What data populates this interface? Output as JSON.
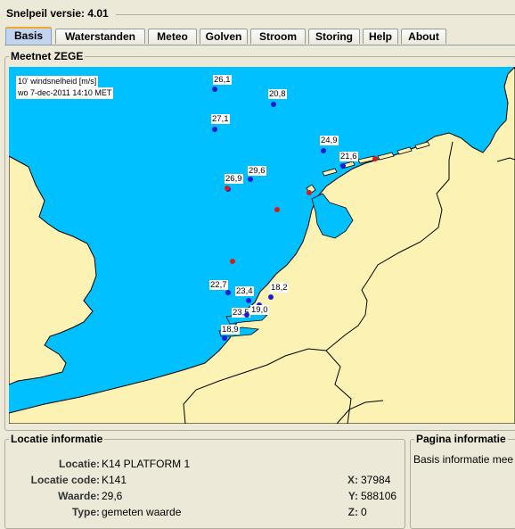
{
  "window": {
    "title": "Snelpeil versie: 4.01"
  },
  "tabs": [
    {
      "label": "Basis",
      "active": true
    },
    {
      "label": "Waterstanden"
    },
    {
      "label": "Meteo"
    },
    {
      "label": "Golven"
    },
    {
      "label": "Stroom"
    },
    {
      "label": "Storing"
    },
    {
      "label": "Help"
    },
    {
      "label": "About"
    }
  ],
  "map_panel": {
    "title": "Meetnet ZEGE",
    "legend_line1": "10' windsnelheid [m/s]",
    "legend_line2": "wo 7-dec-2011 14:10 MET",
    "colors": {
      "sea": "#00c0ff",
      "land": "#fcf2b4",
      "border": "#000000",
      "station": "#1c1cd6",
      "marker": "#d41c1c"
    },
    "stations": [
      {
        "value": "26,1"
      },
      {
        "value": "20,8"
      },
      {
        "value": "27,1"
      },
      {
        "value": "24,9"
      },
      {
        "value": "21,6"
      },
      {
        "value": "26,9"
      },
      {
        "value": "29,6"
      },
      {
        "value": "22,7"
      },
      {
        "value": "23,4"
      },
      {
        "value": "18,2"
      },
      {
        "value": "23,5"
      },
      {
        "value": "19,0"
      },
      {
        "value": "18,9"
      }
    ]
  },
  "locatie_info": {
    "title": "Locatie informatie",
    "locatie_label": "Locatie:",
    "locatie_value": "K14 PLATFORM 1",
    "code_label": "Locatie code:",
    "code_value": "K141",
    "waarde_label": "Waarde:",
    "waarde_value": "29,6",
    "type_label": "Type:",
    "type_value": "gemeten waarde",
    "x_label": "X:",
    "x_value": "37984",
    "y_label": "Y:",
    "y_value": "588106",
    "z_label": "Z:",
    "z_value": "0"
  },
  "pagina_info": {
    "title": "Pagina informatie",
    "text": "Basis informatie mee"
  }
}
